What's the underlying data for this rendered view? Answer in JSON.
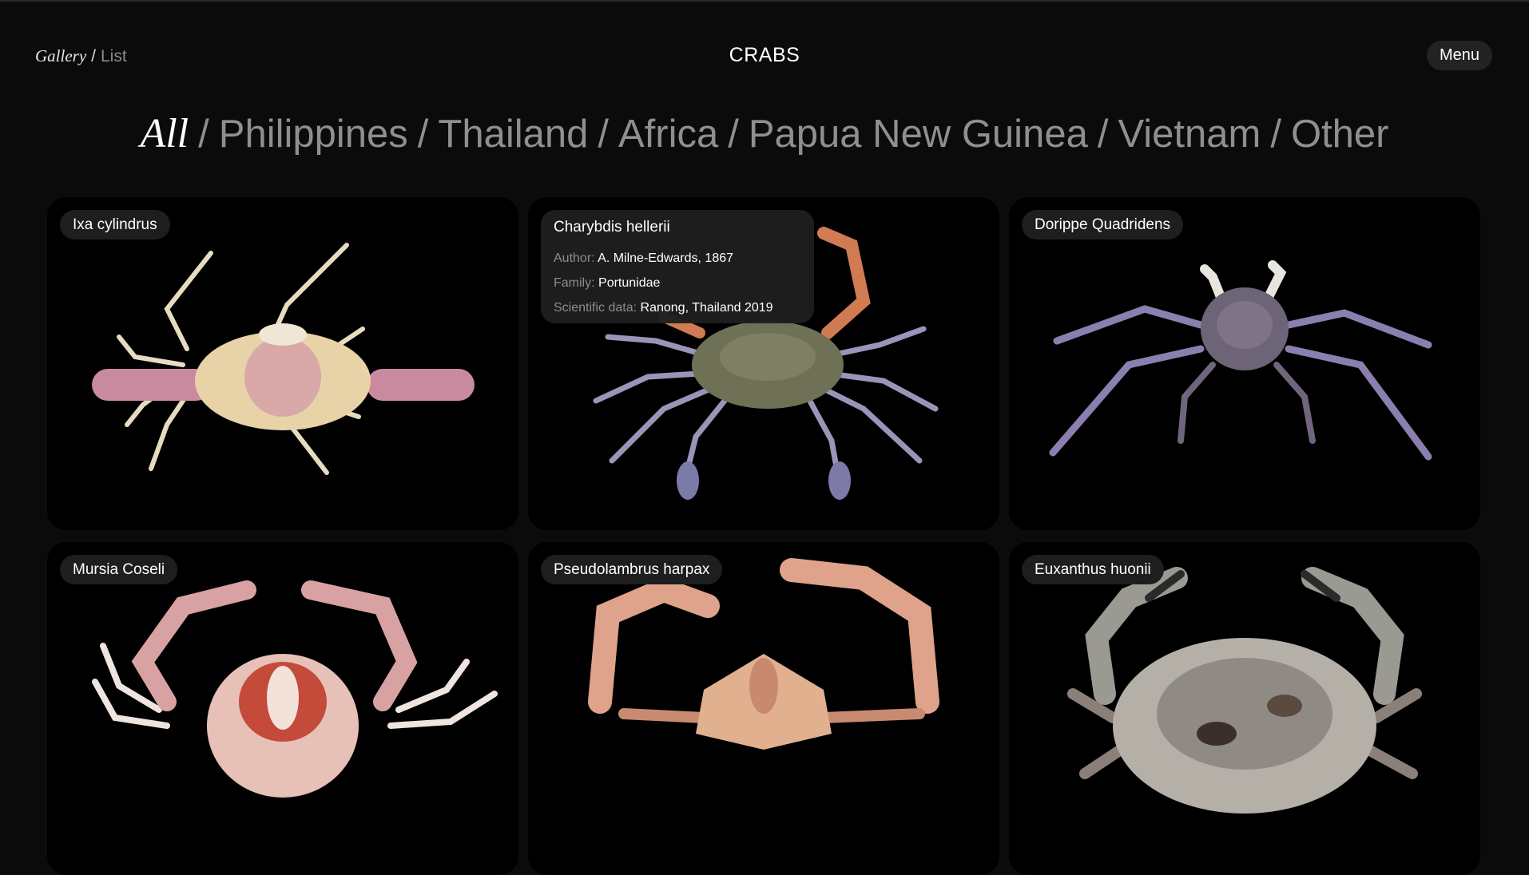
{
  "header": {
    "view_gallery": "Gallery",
    "view_separator": "/",
    "view_list": "List",
    "title": "CRABS",
    "menu_label": "Menu"
  },
  "filters": {
    "items": [
      "All",
      "Philippines",
      "Thailand",
      "Africa",
      "Papua New Guinea",
      "Vietnam",
      "Other"
    ],
    "active": "All",
    "separator": "/"
  },
  "cards": [
    {
      "name": "Ixa cylindrus"
    },
    {
      "name": "Charybdis hellerii",
      "details": {
        "author_label": "Author:",
        "author": "A. Milne-Edwards, 1867",
        "family_label": "Family:",
        "family": "Portunidae",
        "scientific_label": "Scientific data:",
        "scientific": "Ranong, Thailand 2019"
      }
    },
    {
      "name": "Dorippe Quadridens"
    },
    {
      "name": "Mursia Coseli"
    },
    {
      "name": "Pseudolambrus harpax"
    },
    {
      "name": "Euxanthus huonii"
    }
  ],
  "colors": {
    "background": "#0b0b0b",
    "card": "#000000",
    "pill": "#1e1e1e",
    "muted_text": "#8f8f8f"
  }
}
